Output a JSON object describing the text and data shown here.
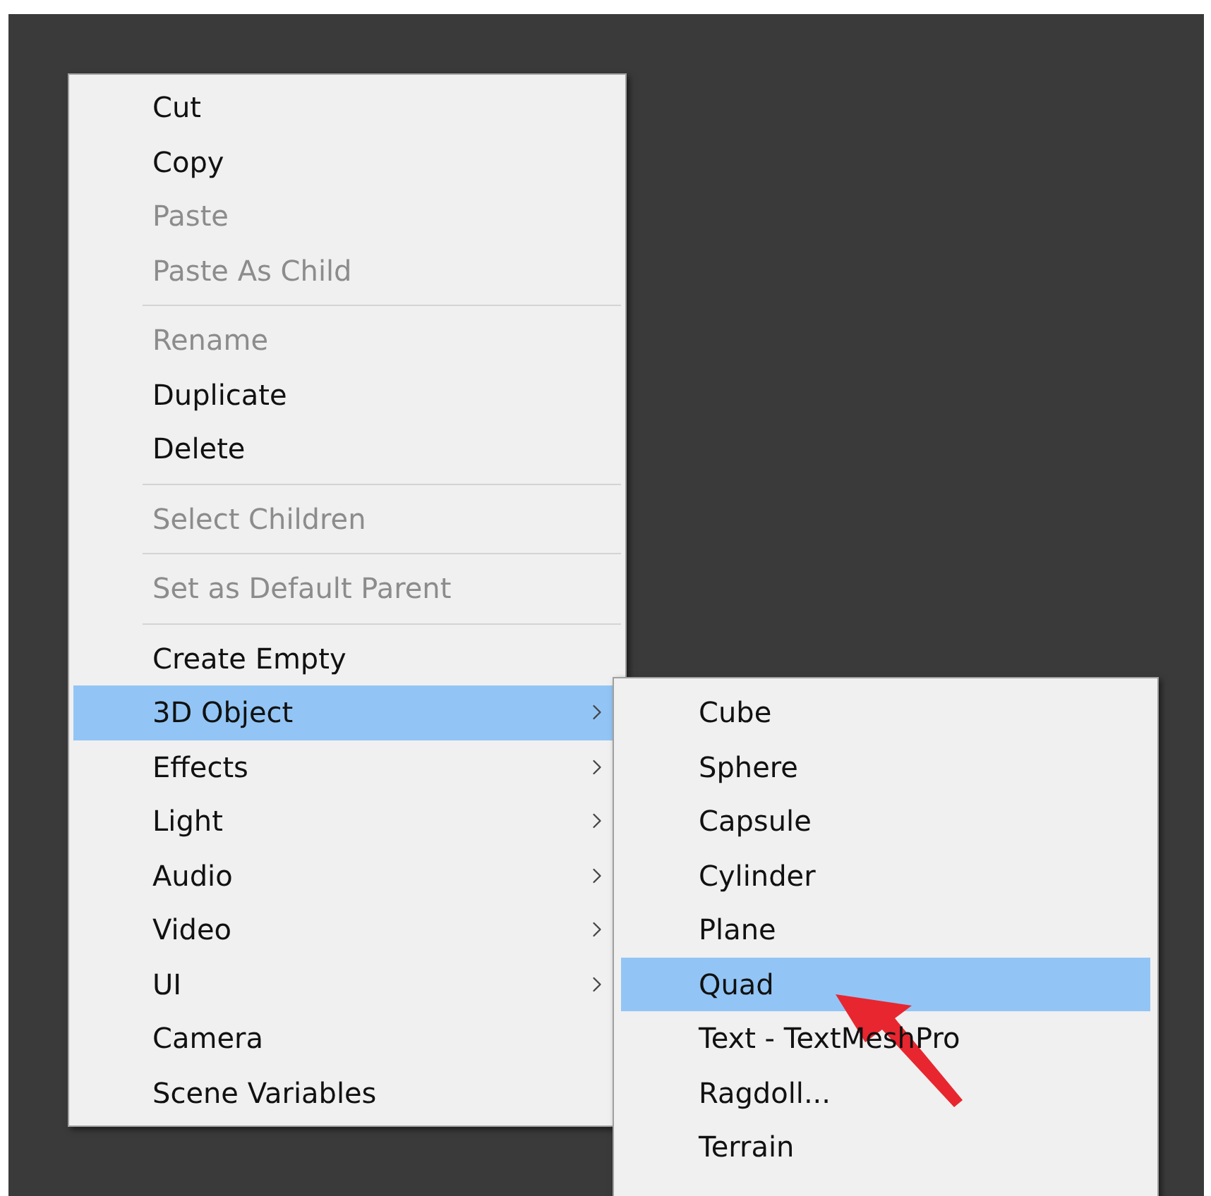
{
  "context_menu": {
    "items": [
      {
        "kind": "item",
        "label": "Cut",
        "disabled": false,
        "selected": false,
        "has_submenu": false
      },
      {
        "kind": "item",
        "label": "Copy",
        "disabled": false,
        "selected": false,
        "has_submenu": false
      },
      {
        "kind": "item",
        "label": "Paste",
        "disabled": true,
        "selected": false,
        "has_submenu": false
      },
      {
        "kind": "item",
        "label": "Paste As Child",
        "disabled": true,
        "selected": false,
        "has_submenu": false
      },
      {
        "kind": "separator"
      },
      {
        "kind": "item",
        "label": "Rename",
        "disabled": true,
        "selected": false,
        "has_submenu": false
      },
      {
        "kind": "item",
        "label": "Duplicate",
        "disabled": false,
        "selected": false,
        "has_submenu": false
      },
      {
        "kind": "item",
        "label": "Delete",
        "disabled": false,
        "selected": false,
        "has_submenu": false
      },
      {
        "kind": "separator"
      },
      {
        "kind": "item",
        "label": "Select Children",
        "disabled": true,
        "selected": false,
        "has_submenu": false
      },
      {
        "kind": "separator"
      },
      {
        "kind": "item",
        "label": "Set as Default Parent",
        "disabled": true,
        "selected": false,
        "has_submenu": false
      },
      {
        "kind": "separator"
      },
      {
        "kind": "item",
        "label": "Create Empty",
        "disabled": false,
        "selected": false,
        "has_submenu": false
      },
      {
        "kind": "item",
        "label": "3D Object",
        "disabled": false,
        "selected": true,
        "has_submenu": true
      },
      {
        "kind": "item",
        "label": "Effects",
        "disabled": false,
        "selected": false,
        "has_submenu": true
      },
      {
        "kind": "item",
        "label": "Light",
        "disabled": false,
        "selected": false,
        "has_submenu": true
      },
      {
        "kind": "item",
        "label": "Audio",
        "disabled": false,
        "selected": false,
        "has_submenu": true
      },
      {
        "kind": "item",
        "label": "Video",
        "disabled": false,
        "selected": false,
        "has_submenu": true
      },
      {
        "kind": "item",
        "label": "UI",
        "disabled": false,
        "selected": false,
        "has_submenu": true
      },
      {
        "kind": "item",
        "label": "Camera",
        "disabled": false,
        "selected": false,
        "has_submenu": false
      },
      {
        "kind": "item",
        "label": "Scene Variables",
        "disabled": false,
        "selected": false,
        "has_submenu": false
      }
    ]
  },
  "submenu": {
    "items": [
      {
        "label": "Cube",
        "selected": false
      },
      {
        "label": "Sphere",
        "selected": false
      },
      {
        "label": "Capsule",
        "selected": false
      },
      {
        "label": "Cylinder",
        "selected": false
      },
      {
        "label": "Plane",
        "selected": false
      },
      {
        "label": "Quad",
        "selected": true
      },
      {
        "label": "Text - TextMeshPro",
        "selected": false
      },
      {
        "label": "Ragdoll...",
        "selected": false
      },
      {
        "label": "Terrain",
        "selected": false
      }
    ]
  }
}
